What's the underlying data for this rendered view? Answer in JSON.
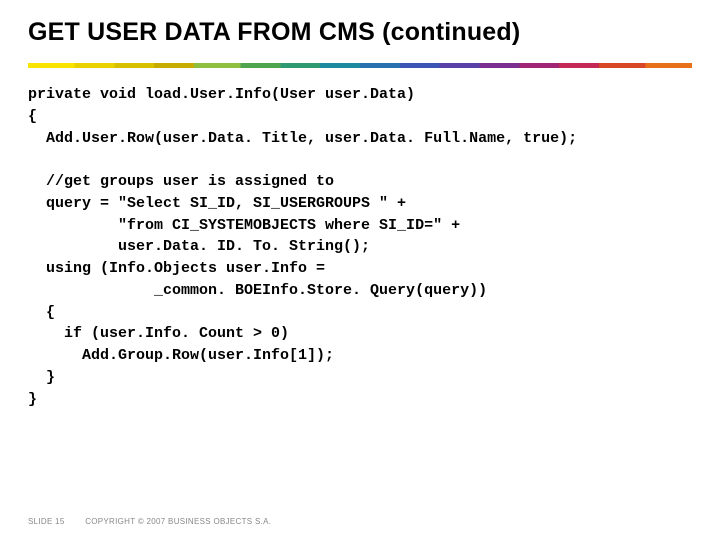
{
  "title": "GET USER DATA FROM CMS (continued)",
  "code": "private void load.User.Info(User user.Data)\n{\n  Add.User.Row(user.Data. Title, user.Data. Full.Name, true);\n\n  //get groups user is assigned to\n  query = \"Select SI_ID, SI_USERGROUPS \" +\n          \"from CI_SYSTEMOBJECTS where SI_ID=\" +\n          user.Data. ID. To. String();\n  using (Info.Objects user.Info =\n              _common. BOEInfo.Store. Query(query))\n  {\n    if (user.Info. Count > 0)\n      Add.Group.Row(user.Info[1]);\n  }\n}",
  "footer": {
    "slide": "SLIDE 15",
    "copyright": "COPYRIGHT © 2007 BUSINESS OBJECTS S.A."
  }
}
